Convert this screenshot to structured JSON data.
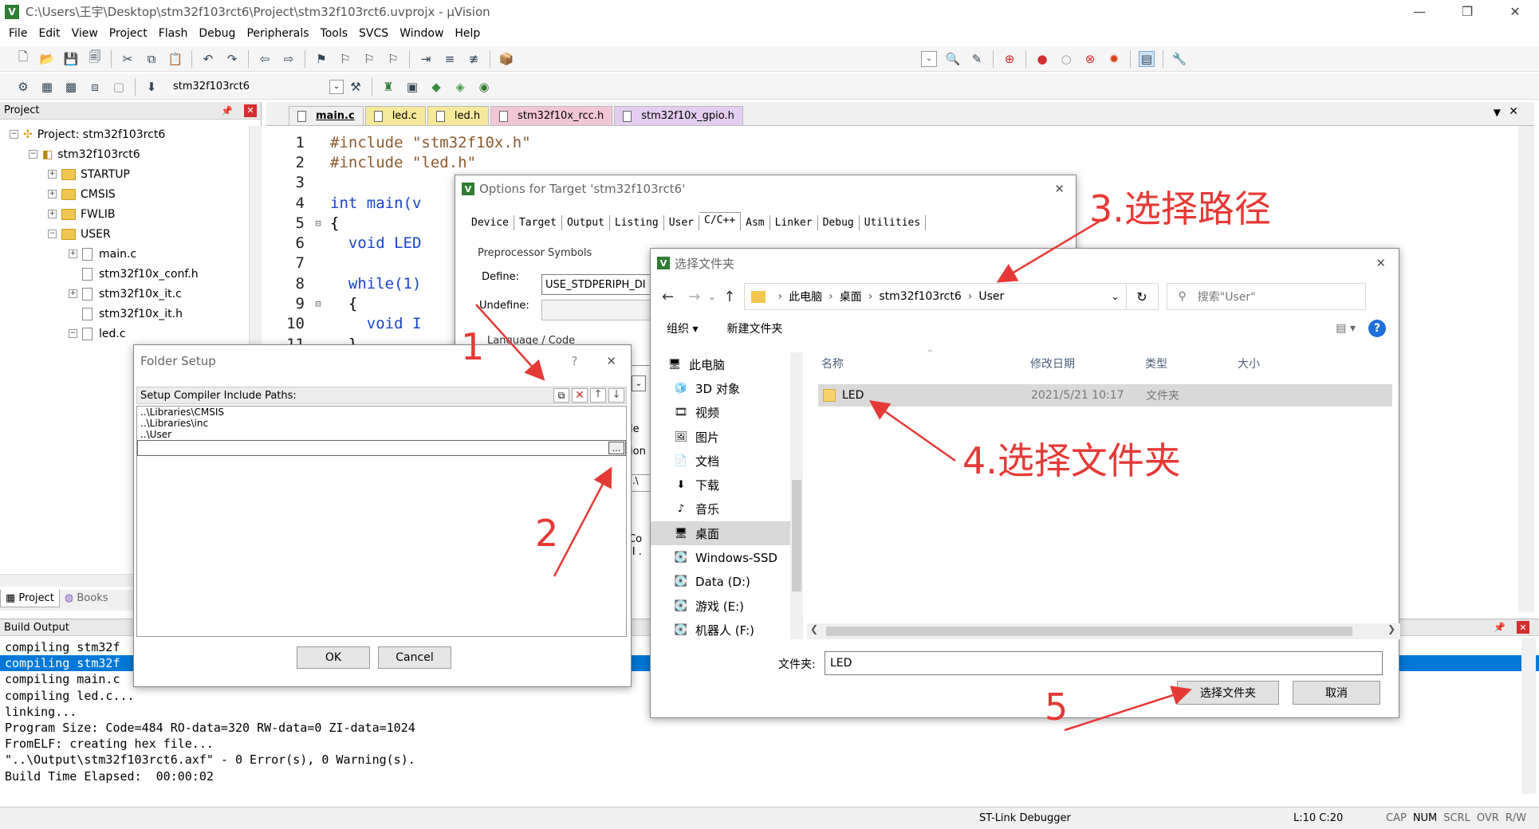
{
  "window": {
    "title": "C:\\Users\\王宇\\Desktop\\stm32f103rct6\\Project\\stm32f103rct6.uvprojx - µVision",
    "minimize": "—",
    "maximize": "❐",
    "close": "✕"
  },
  "menu": [
    "File",
    "Edit",
    "View",
    "Project",
    "Flash",
    "Debug",
    "Peripherals",
    "Tools",
    "SVCS",
    "Window",
    "Help"
  ],
  "toolbar2": {
    "target": "stm32f103rct6"
  },
  "project_panel": {
    "header": "Project",
    "root": "Project: stm32f103rct6",
    "target": "stm32f103rct6",
    "groups": [
      "STARTUP",
      "CMSIS",
      "FWLIB",
      "USER"
    ],
    "user_files": [
      "main.c",
      "stm32f10x_conf.h",
      "stm32f10x_it.c",
      "stm32f10x_it.h",
      "led.c"
    ],
    "tabs": [
      "Project",
      "Books"
    ]
  },
  "editor": {
    "tabs": [
      {
        "label": "main.c",
        "color": "#f0f0f0"
      },
      {
        "label": "led.c",
        "color": "#f7e99a"
      },
      {
        "label": "led.h",
        "color": "#f7e99a"
      },
      {
        "label": "stm32f10x_rcc.h",
        "color": "#f3c6d6"
      },
      {
        "label": "stm32f10x_gpio.h",
        "color": "#e3cdf0"
      }
    ],
    "lines": [
      {
        "n": "1",
        "t": "#include \"stm32f10x.h\""
      },
      {
        "n": "2",
        "t": "#include \"led.h\""
      },
      {
        "n": "3",
        "t": ""
      },
      {
        "n": "4",
        "t": "int main(v"
      },
      {
        "n": "5",
        "t": "{"
      },
      {
        "n": "6",
        "t": "  void LED"
      },
      {
        "n": "7",
        "t": ""
      },
      {
        "n": "8",
        "t": "  while(1)"
      },
      {
        "n": "9",
        "t": "  {"
      },
      {
        "n": "10",
        "t": "    void I"
      },
      {
        "n": "11",
        "t": "  }"
      }
    ]
  },
  "options_dialog": {
    "title": "Options for Target 'stm32f103rct6'",
    "tabs": [
      "Device",
      "Target",
      "Output",
      "Listing",
      "User",
      "C/C++",
      "Asm",
      "Linker",
      "Debug",
      "Utilities"
    ],
    "group1": "Preprocessor Symbols",
    "define_label": "Define:",
    "define_value": "USE_STDPERIPH_DI",
    "undefine_label": "Undefine:",
    "group2": "Language / Code Generation",
    "frag1": "le",
    "frag2": "ion",
    "frag3": "..\\",
    "frag4": "Co",
    "frag5": "-I ."
  },
  "folder_setup": {
    "title": "Folder Setup",
    "help": "?",
    "close": "✕",
    "label": "Setup Compiler Include Paths:",
    "paths": [
      "..\\Libraries\\CMSIS",
      "..\\Libraries\\inc",
      "..\\User"
    ],
    "browse": "...",
    "ok": "OK",
    "cancel": "Cancel"
  },
  "browse_dialog": {
    "title": "选择文件夹",
    "close": "✕",
    "breadcrumb": [
      "此电脑",
      "桌面",
      "stm32f103rct6",
      "User"
    ],
    "search_placeholder": "搜索\"User\"",
    "organize": "组织 ▾",
    "new_folder": "新建文件夹",
    "columns": [
      "名称",
      "修改日期",
      "类型",
      "大小"
    ],
    "nav": [
      "此电脑",
      "3D 对象",
      "视频",
      "图片",
      "文档",
      "下载",
      "音乐",
      "桌面",
      "Windows-SSD",
      "Data (D:)",
      "游戏 (E:)",
      "机器人 (F:)"
    ],
    "files": [
      {
        "name": "LED",
        "date": "2021/5/21 10:17",
        "type": "文件夹"
      }
    ],
    "folder_label": "文件夹:",
    "folder_value": "LED",
    "select_btn": "选择文件夹",
    "cancel_btn": "取消"
  },
  "build_output": {
    "header": "Build Output",
    "lines": [
      "compiling stm32f",
      "compiling stm32f",
      "compiling main.c",
      "compiling led.c...",
      "linking...",
      "Program Size: Code=484 RO-data=320 RW-data=0 ZI-data=1024",
      "FromELF: creating hex file...",
      "\"..\\Output\\stm32f103rct6.axf\" - 0 Error(s), 0 Warning(s).",
      "Build Time Elapsed:  00:00:02"
    ]
  },
  "statusbar": {
    "debugger": "ST-Link Debugger",
    "pos": "L:10 C:20",
    "flags": [
      "CAP",
      "NUM",
      "SCRL",
      "OVR",
      "R/W"
    ]
  },
  "annotations": {
    "a1": "1",
    "a2": "2",
    "a3": "3.选择路径",
    "a4": "4.选择文件夹",
    "a5": "5"
  }
}
